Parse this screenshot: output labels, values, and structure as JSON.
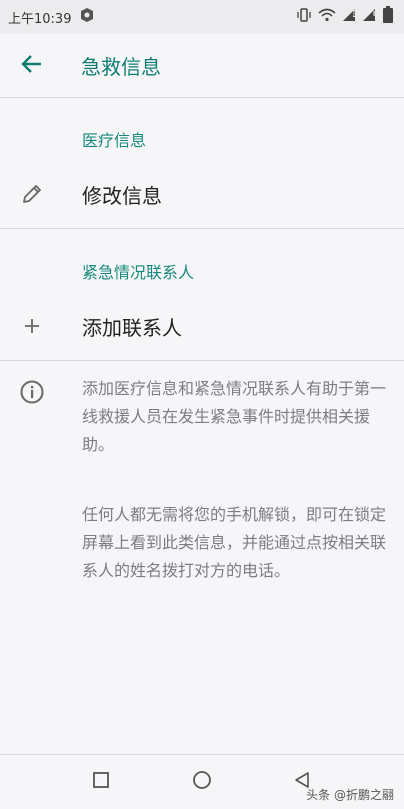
{
  "status_bar": {
    "time": "上午10:39"
  },
  "app_bar": {
    "title": "急救信息"
  },
  "medical_section": {
    "header": "医疗信息",
    "edit_label": "修改信息"
  },
  "emergency_section": {
    "header": "紧急情况联系人",
    "add_label": "添加联系人"
  },
  "info": {
    "paragraph1": "添加医疗信息和紧急情况联系人有助于第一线救援人员在发生紧急事件时提供相关援助。",
    "paragraph2": "任何人都无需将您的手机解锁，即可在锁定屏幕上看到此类信息，并能通过点按相关联系人的姓名拨打对方的电话。"
  },
  "watermark": {
    "text": "头条 @折鹏之翮"
  },
  "colors": {
    "accent": "#107d72",
    "section": "#16897c",
    "body_text": "#7d7d82"
  }
}
